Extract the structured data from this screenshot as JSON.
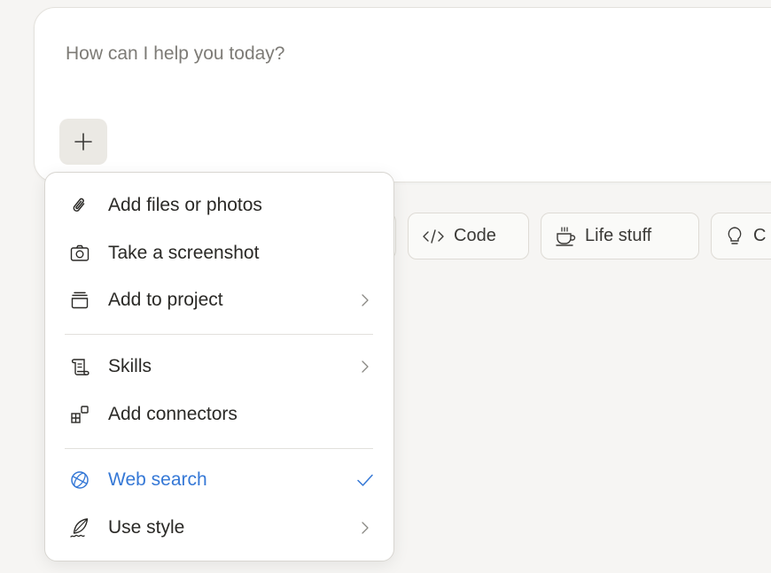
{
  "composer": {
    "placeholder": "How can I help you today?"
  },
  "chips": [
    {
      "label": "Code",
      "icon": "code-icon"
    },
    {
      "label": "Life stuff",
      "icon": "coffee-cup-icon"
    },
    {
      "label": "C",
      "icon": "lightbulb-icon"
    }
  ],
  "menu": {
    "items": [
      {
        "label": "Add files or photos",
        "icon": "paperclip-icon"
      },
      {
        "label": "Take a screenshot",
        "icon": "camera-icon"
      },
      {
        "label": "Add to project",
        "icon": "project-stack-icon",
        "has_submenu": true
      },
      {
        "label": "Skills",
        "icon": "scroll-icon",
        "has_submenu": true
      },
      {
        "label": "Add connectors",
        "icon": "connectors-grid-icon"
      },
      {
        "label": "Web search",
        "icon": "globe-icon",
        "checked": true
      },
      {
        "label": "Use style",
        "icon": "quill-icon",
        "has_submenu": true
      }
    ]
  },
  "colors": {
    "accent": "#3578d6",
    "background": "#f6f5f3",
    "composer_bg": "#ffffff",
    "plus_button_bg": "#ebe9e4"
  }
}
